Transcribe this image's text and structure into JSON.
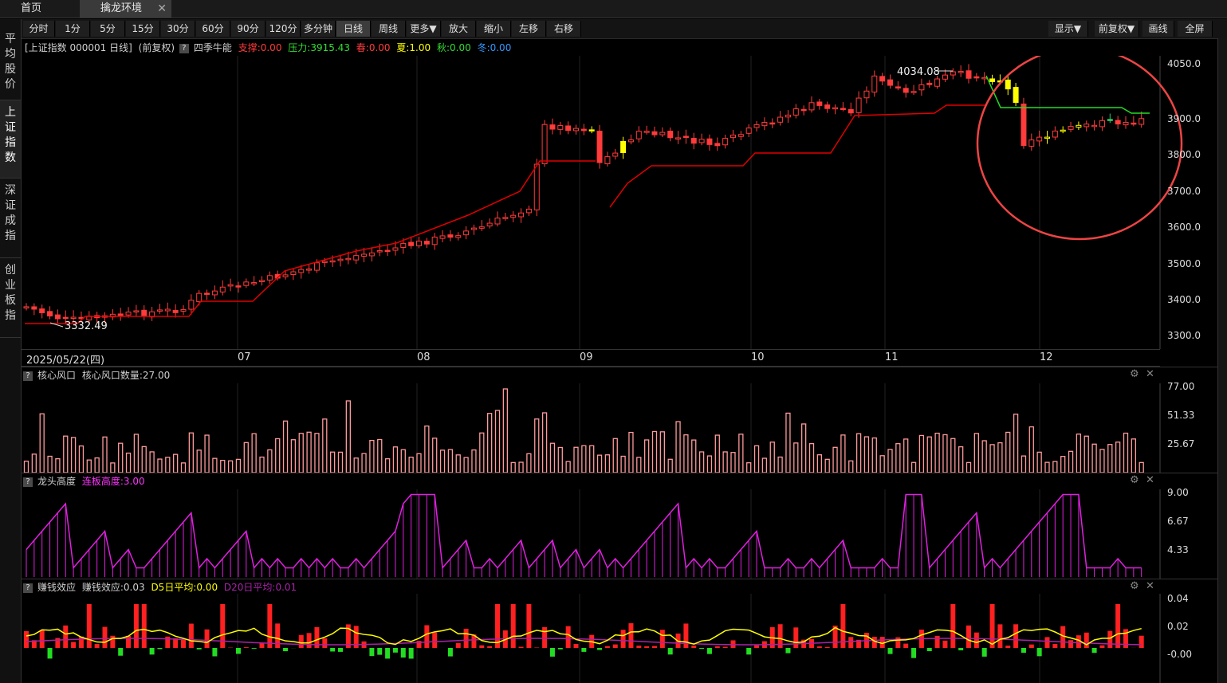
{
  "tabs": [
    {
      "label": "首页",
      "active": false
    },
    {
      "label": "擒龙环境",
      "active": true,
      "close": "✕"
    }
  ],
  "toolbar": {
    "periods": [
      "分时",
      "1分",
      "5分",
      "15分",
      "30分",
      "60分",
      "90分",
      "120分",
      "多分钟",
      "日线",
      "周线"
    ],
    "active_period": "日线",
    "more": "更多▼",
    "zoom_in": "放大",
    "zoom_out": "缩小",
    "left": "左移",
    "right": "右移",
    "display": "显示▼",
    "adjust": "前复权▼",
    "draw": "画线",
    "fullscreen": "全屏"
  },
  "sidebar": {
    "items": [
      "平均股价",
      "上证指数",
      "深证成指",
      "创业板指"
    ],
    "active": 1
  },
  "main_info": {
    "title": "[上证指数 000001 日线]",
    "adj": "(前复权)",
    "qmark": "?",
    "indicator": "四季牛能",
    "support": "支撑:0.00",
    "pressure": "压力:3915.43",
    "spring": "春:0.00",
    "summer": "夏:1.00",
    "autumn": "秋:0.00",
    "winter": "冬:0.00",
    "colors": {
      "support": "#ff3b3b",
      "pressure": "#33dd33",
      "spring": "#ff3b3b",
      "summer": "#ffff00",
      "autumn": "#33dd33",
      "winter": "#3399ff"
    }
  },
  "price_axis": [
    "4050.0",
    "3900.0",
    "3800.0",
    "3700.0",
    "3600.0",
    "3500.0",
    "3400.0",
    "3300.0"
  ],
  "annotations": {
    "high": "4034.08",
    "low": "3332.49"
  },
  "date_axis": {
    "first": "2025/05/22(四)",
    "months": [
      "07",
      "08",
      "09",
      "10",
      "11",
      "12"
    ]
  },
  "pane1": {
    "title": "核心风口",
    "detail": "核心风口数量:27.00",
    "axis": [
      "77.00",
      "51.33",
      "25.67"
    ]
  },
  "pane2": {
    "title": "龙头高度",
    "detail": "连板高度:3.00",
    "axis": [
      "9.00",
      "6.67",
      "4.33"
    ],
    "detail_color": "#ff33ff"
  },
  "pane3": {
    "title": "赚钱效应",
    "detail": "赚钱效应:0.03",
    "d5": "D5日平均:0.00",
    "d20": "D20日平均:0.01",
    "axis": [
      "0.04",
      "0.02",
      "-0.00"
    ],
    "d5_color": "#ffff00",
    "d20_color": "#aa22aa"
  },
  "pane_controls": {
    "gear": "⚙",
    "close": "✕"
  },
  "colors": {
    "up": "#ff3b3b",
    "down_highlight": "#ffff00",
    "green": "#33cc66",
    "circle": "#ee4444",
    "support_line": "#e00000",
    "pressure_line": "#22dd22",
    "bar_pink": "#ff9a9a",
    "magenta": "#e020e0"
  }
}
